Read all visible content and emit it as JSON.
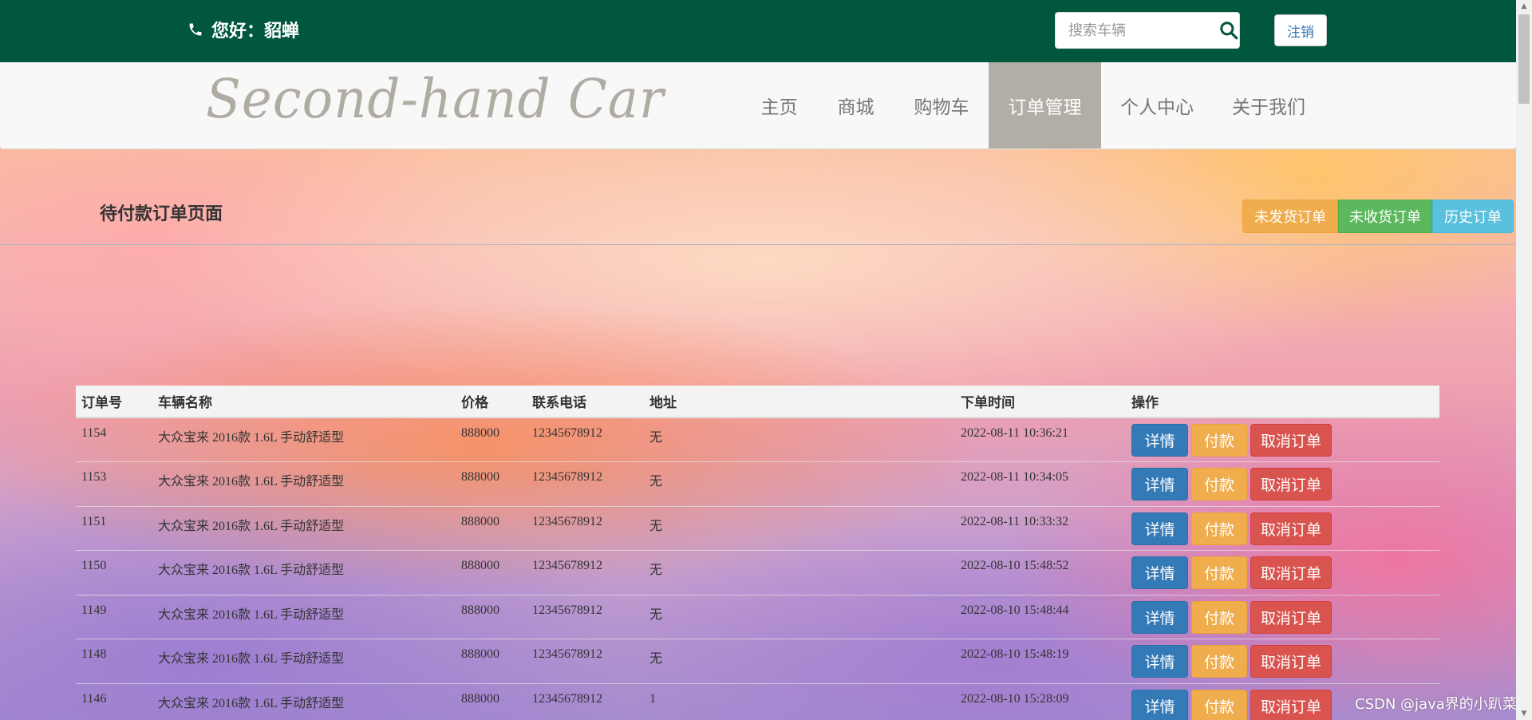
{
  "topbar": {
    "greeting": "您好：貂蝉",
    "search_placeholder": "搜索车辆",
    "logout_label": "注销"
  },
  "navbar": {
    "logo_text": "Second-hand Car",
    "items": [
      {
        "label": "主页",
        "active": false
      },
      {
        "label": "商城",
        "active": false
      },
      {
        "label": "购物车",
        "active": false
      },
      {
        "label": "订单管理",
        "active": true
      },
      {
        "label": "个人中心",
        "active": false
      },
      {
        "label": "关于我们",
        "active": false
      }
    ]
  },
  "page": {
    "title": "待付款订单页面",
    "buttons": {
      "unshipped": "未发货订单",
      "unreceived": "未收货订单",
      "history": "历史订单"
    }
  },
  "table": {
    "columns": [
      "订单号",
      "车辆名称",
      "价格",
      "联系电话",
      "地址",
      "下单时间",
      "操作"
    ],
    "rows": [
      {
        "id": "1154",
        "name": "大众宝来 2016款 1.6L 手动舒适型",
        "price": "888000",
        "phone": "12345678912",
        "address": "无",
        "time": "2022-08-11 10:36:21"
      },
      {
        "id": "1153",
        "name": "大众宝来 2016款 1.6L 手动舒适型",
        "price": "888000",
        "phone": "12345678912",
        "address": "无",
        "time": "2022-08-11 10:34:05"
      },
      {
        "id": "1151",
        "name": "大众宝来 2016款 1.6L 手动舒适型",
        "price": "888000",
        "phone": "12345678912",
        "address": "无",
        "time": "2022-08-11 10:33:32"
      },
      {
        "id": "1150",
        "name": "大众宝来 2016款 1.6L 手动舒适型",
        "price": "888000",
        "phone": "12345678912",
        "address": "无",
        "time": "2022-08-10 15:48:52"
      },
      {
        "id": "1149",
        "name": "大众宝来 2016款 1.6L 手动舒适型",
        "price": "888000",
        "phone": "12345678912",
        "address": "无",
        "time": "2022-08-10 15:48:44"
      },
      {
        "id": "1148",
        "name": "大众宝来 2016款 1.6L 手动舒适型",
        "price": "888000",
        "phone": "12345678912",
        "address": "无",
        "time": "2022-08-10 15:48:19"
      },
      {
        "id": "1146",
        "name": "大众宝来 2016款 1.6L 手动舒适型",
        "price": "888000",
        "phone": "12345678912",
        "address": "1",
        "time": "2022-08-10 15:28:09"
      }
    ],
    "actions": {
      "detail": "详情",
      "pay": "付款",
      "cancel": "取消订单"
    }
  },
  "watermark": "CSDN @java界的小趴菜",
  "icons": {
    "phone": "phone-icon",
    "search": "search-icon"
  },
  "colors": {
    "topbar": "#00573e",
    "nav_active": "#b2ada5",
    "primary": "#337ab7",
    "warning": "#f0ad4e",
    "success": "#5cb85c",
    "info": "#5bc0de",
    "danger": "#d9534f"
  }
}
